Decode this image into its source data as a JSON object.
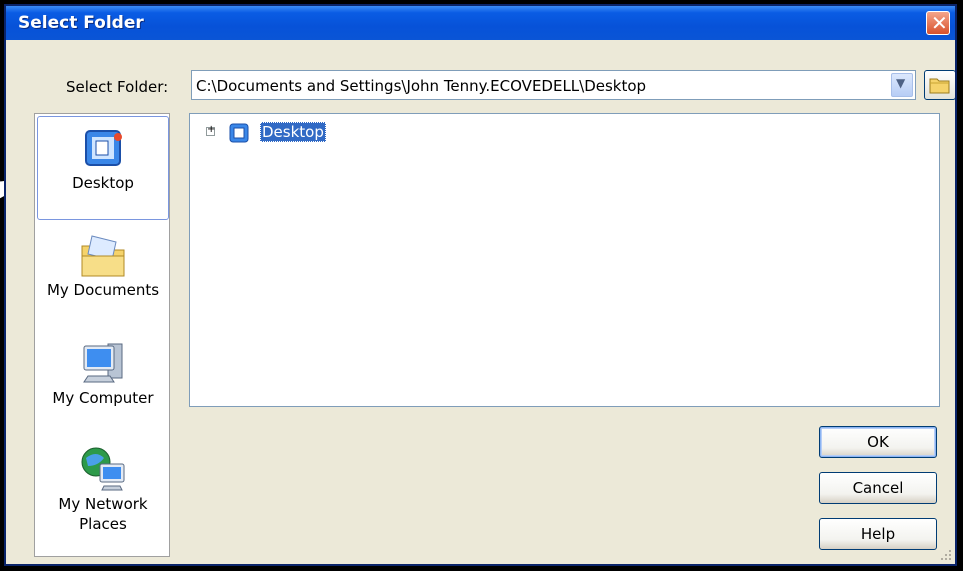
{
  "window": {
    "title": "Select Folder"
  },
  "icons": {
    "close": "close-icon",
    "dropdown": "chevron-down-icon",
    "new_folder": "new-folder-icon",
    "desktop": "desktop-icon",
    "documents": "my-documents-icon",
    "computer": "my-computer-icon",
    "network": "network-places-icon"
  },
  "path": {
    "label": "Select Folder:",
    "value": "C:\\Documents and Settings\\John Tenny.ECOVEDELL\\Desktop"
  },
  "places": [
    {
      "label": "Desktop",
      "selected": true
    },
    {
      "label": "My Documents",
      "selected": false
    },
    {
      "label": "My Computer",
      "selected": false
    },
    {
      "label": "My Network\nPlaces",
      "selected": false
    }
  ],
  "tree": {
    "expander": "⊞",
    "root_label": "Desktop",
    "root_selected": true
  },
  "buttons": {
    "ok": "OK",
    "cancel": "Cancel",
    "help": "Help"
  },
  "colors": {
    "title_bar": "#0752D8",
    "dialog_bg": "#ECE9D8",
    "selection": "#316AC5",
    "close_button": "#D8512C"
  }
}
